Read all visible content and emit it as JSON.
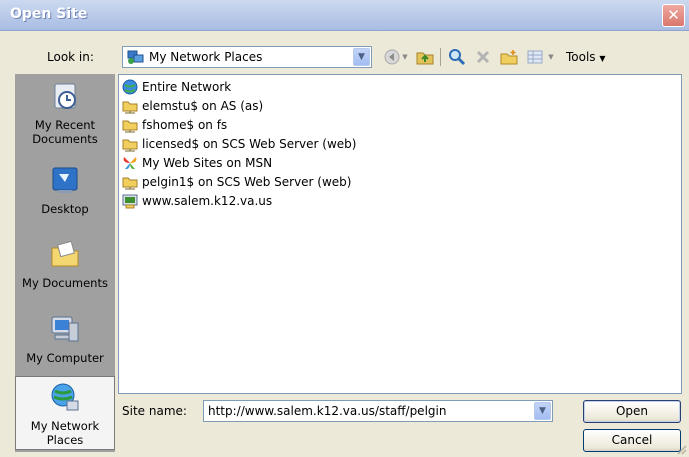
{
  "window": {
    "title": "Open Site",
    "close_label": "✕"
  },
  "toolbar": {
    "look_in_label": "Look in:",
    "look_in_value": "My Network Places",
    "look_in_icon": "network-places-icon",
    "tools_label": "Tools",
    "buttons": [
      "back-icon",
      "up-folder-icon",
      "search-web-icon",
      "delete-icon",
      "new-folder-icon",
      "views-icon"
    ]
  },
  "places": [
    {
      "label": "My Recent Documents",
      "icon": "recent-documents-icon",
      "selected": false
    },
    {
      "label": "Desktop",
      "icon": "desktop-icon",
      "selected": false
    },
    {
      "label": "My Documents",
      "icon": "my-documents-icon",
      "selected": false
    },
    {
      "label": "My Computer",
      "icon": "my-computer-icon",
      "selected": false
    },
    {
      "label": "My Network Places",
      "icon": "network-places-icon",
      "selected": true
    }
  ],
  "files": [
    {
      "name": "Entire Network",
      "icon": "globe-icon"
    },
    {
      "name": "elemstu$ on AS (as)",
      "icon": "network-share-icon"
    },
    {
      "name": "fshome$ on fs",
      "icon": "network-share-icon"
    },
    {
      "name": "licensed$ on SCS Web Server (web)",
      "icon": "network-share-icon"
    },
    {
      "name": "My Web Sites on MSN",
      "icon": "msn-butterfly-icon"
    },
    {
      "name": "pelgin1$ on SCS Web Server (web)",
      "icon": "network-share-icon"
    },
    {
      "name": "www.salem.k12.va.us",
      "icon": "ftp-folder-icon"
    }
  ],
  "footer": {
    "site_name_label": "Site name:",
    "site_name_value": "http://www.salem.k12.va.us/staff/pelgin",
    "open_label": "Open",
    "cancel_label": "Cancel"
  }
}
